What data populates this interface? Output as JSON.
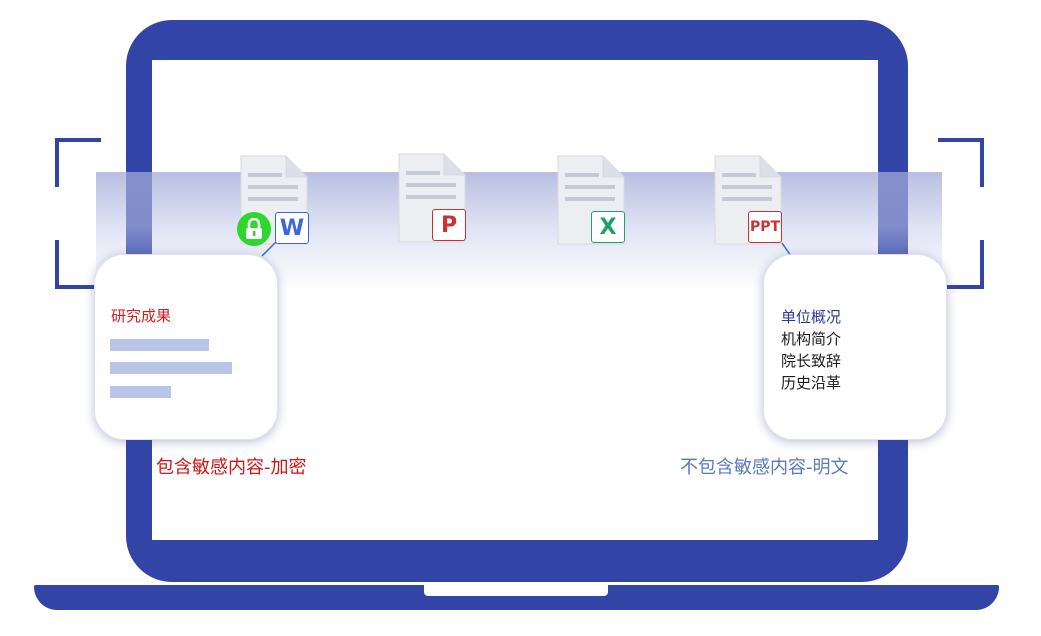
{
  "documents": [
    {
      "type": "word",
      "badge": "W",
      "color": "#3c68d8",
      "icon": "word-document-icon",
      "encrypted": true
    },
    {
      "type": "pdf",
      "badge": "P",
      "color": "#c83232",
      "icon": "pdf-document-icon",
      "encrypted": false
    },
    {
      "type": "excel",
      "badge": "X",
      "color": "#1f9f6a",
      "icon": "excel-document-icon",
      "encrypted": false
    },
    {
      "type": "ppt",
      "badge": "PPT",
      "color": "#c83232",
      "icon": "ppt-document-icon",
      "encrypted": false
    }
  ],
  "lock": {
    "icon": "padlock-icon",
    "color": "#2ed62e"
  },
  "left_card": {
    "title": "研究成果"
  },
  "right_card": {
    "lines": [
      "单位概况",
      "机构简介",
      "院长致辞",
      "历史沿革"
    ]
  },
  "captions": {
    "sensitive": "包含敏感内容-加密",
    "plain": "不包含敏感内容-明文"
  },
  "colors": {
    "frame": "#3245a7",
    "sensitive_text": "#d01515",
    "plain_text": "#5b78c2"
  }
}
